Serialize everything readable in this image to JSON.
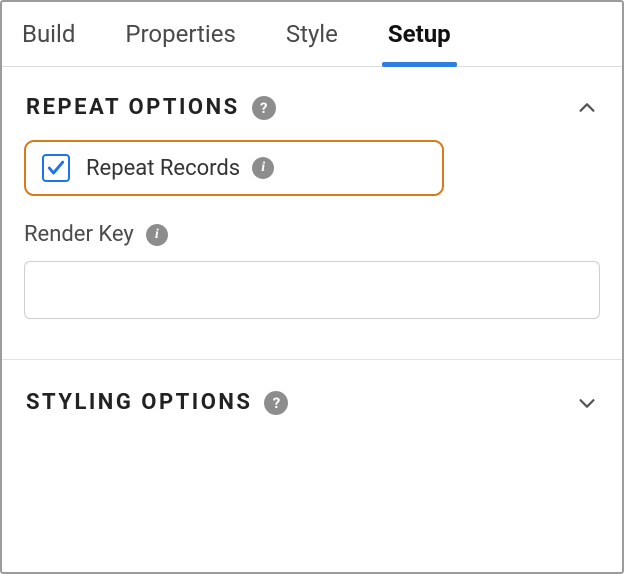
{
  "tabs": {
    "build": "Build",
    "properties": "Properties",
    "style": "Style",
    "setup": "Setup"
  },
  "repeat": {
    "title": "REPEAT OPTIONS",
    "checkbox_label": "Repeat Records",
    "checked": true,
    "render_key_label": "Render Key",
    "render_key_value": ""
  },
  "styling": {
    "title": "STYLING OPTIONS"
  }
}
